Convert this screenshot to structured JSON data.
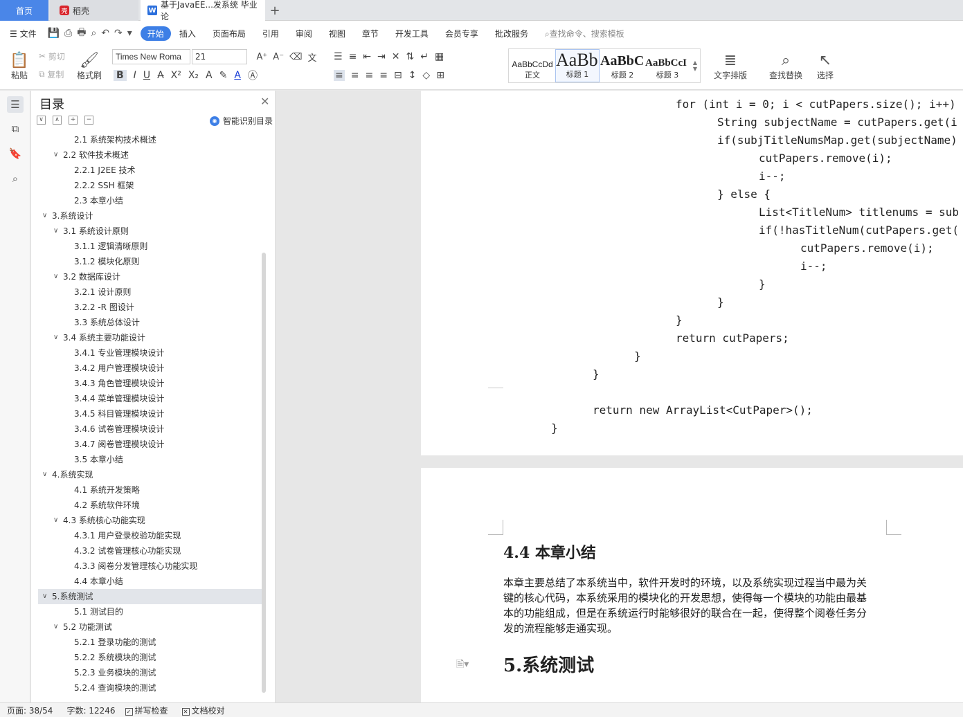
{
  "tabs": {
    "home": "首页",
    "daoke": "稻壳",
    "doc": "基于JavaEE...发系统 毕业论"
  },
  "menu": {
    "file": "文件",
    "items": [
      "开始",
      "插入",
      "页面布局",
      "引用",
      "审阅",
      "视图",
      "章节",
      "开发工具",
      "会员专享",
      "批改服务"
    ],
    "search_placeholder": "查找命令、搜索模板"
  },
  "ribbon": {
    "paste": "粘贴",
    "cut": "剪切",
    "copy": "复制",
    "format_painter": "格式刷",
    "font_name": "Times New Roma",
    "font_size": "21",
    "styles": [
      {
        "preview": "AaBbCcDd",
        "name": "正文"
      },
      {
        "preview": "AaBb",
        "name": "标题 1"
      },
      {
        "preview": "AaBbC",
        "name": "标题 2"
      },
      {
        "preview": "AaBbCcI",
        "name": "标题 3"
      }
    ],
    "text_layout": "文字排版",
    "find_replace": "查找替换",
    "select": "选择"
  },
  "toc": {
    "title": "目录",
    "smart": "智能识别目录",
    "items": [
      {
        "level": 3,
        "text": "2.1  系统架构技术概述"
      },
      {
        "level": 2,
        "arrow": "∨",
        "text": "2.2  软件技术概述"
      },
      {
        "level": 3,
        "text": "2.2.1 J2EE  技术"
      },
      {
        "level": 3,
        "text": "2.2.2 SSH  框架"
      },
      {
        "level": 3,
        "text": "2.3  本章小结"
      },
      {
        "level": 1,
        "arrow": "∨",
        "text": "3.系统设计"
      },
      {
        "level": 2,
        "arrow": "∨",
        "text": "3.1  系统设计原则"
      },
      {
        "level": 3,
        "text": "3.1.1  逻辑清晰原则"
      },
      {
        "level": 3,
        "text": "3.1.2  模块化原则"
      },
      {
        "level": 2,
        "arrow": "∨",
        "text": "3.2  数据库设计"
      },
      {
        "level": 3,
        "text": "3.2.1  设计原则"
      },
      {
        "level": 3,
        "text": "3.2.2 -R  图设计"
      },
      {
        "level": 3,
        "text": "3.3  系统总体设计"
      },
      {
        "level": 2,
        "arrow": "∨",
        "text": "3.4  系统主要功能设计"
      },
      {
        "level": 3,
        "text": "3.4.1  专业管理模块设计"
      },
      {
        "level": 3,
        "text": "3.4.2 用户管理模块设计"
      },
      {
        "level": 3,
        "text": "3.4.3  角色管理模块设计"
      },
      {
        "level": 3,
        "text": "3.4.4 菜单管理模块设计"
      },
      {
        "level": 3,
        "text": "3.4.5 科目管理模块设计"
      },
      {
        "level": 3,
        "text": "3.4.6  试卷管理模块设计"
      },
      {
        "level": 3,
        "text": "3.4.7  阅卷管理模块设计"
      },
      {
        "level": 3,
        "text": "3.5  本章小结"
      },
      {
        "level": 1,
        "arrow": "∨",
        "text": "4.系统实现"
      },
      {
        "level": 3,
        "text": "4.1  系统开发策略"
      },
      {
        "level": 3,
        "text": "4.2  系统软件环境"
      },
      {
        "level": 2,
        "arrow": "∨",
        "text": "4.3  系统核心功能实现"
      },
      {
        "level": 3,
        "text": "4.3.1  用户登录校验功能实现"
      },
      {
        "level": 3,
        "text": "4.3.2  试卷管理核心功能实现"
      },
      {
        "level": 3,
        "text": "4.3.3  阅卷分发管理核心功能实现"
      },
      {
        "level": 3,
        "text": "4.4  本章小结"
      },
      {
        "level": 1,
        "arrow": "∨",
        "text": "5.系统测试",
        "selected": true
      },
      {
        "level": 3,
        "text": "5.1  测试目的"
      },
      {
        "level": 2,
        "arrow": "∨",
        "text": "5.2  功能测试"
      },
      {
        "level": 3,
        "text": "5.2.1  登录功能的测试"
      },
      {
        "level": 3,
        "text": "5.2.2  系统模块的测试"
      },
      {
        "level": 3,
        "text": "5.2.3  业务模块的测试"
      },
      {
        "level": 3,
        "text": "5.2.4  查询模块的测试"
      }
    ]
  },
  "doc": {
    "code_lines": [
      "for (int i = 0; i < cutPapers.size(); i++)",
      "String subjectName = cutPapers.get(i",
      "if(subjTitleNumsMap.get(subjectName)",
      "cutPapers.remove(i);",
      "i--;",
      "} else {",
      "List<TitleNum> titlenums = sub",
      "if(!hasTitleNum(cutPapers.get(",
      "cutPapers.remove(i);",
      "i--;",
      "}",
      "}",
      "}",
      "return cutPapers;",
      "}",
      "}",
      "return new ArrayList<CutPaper>();",
      "}"
    ],
    "section_44": "4.4  本章小结",
    "paragraph": [
      "本章主要总结了本系统当中，软件开发时的环境，以及系统实现过程当中最为关",
      "键的核心代码，本系统采用的模块化的开发思想，使得每一个模块的功能由最基",
      "本的功能组成，但是在系统运行时能够很好的联合在一起，使得整个阅卷任务分",
      "发的流程能够走通实现。"
    ],
    "chapter_5": "5.系统测试"
  },
  "status": {
    "page": "页面: 38/54",
    "words": "字数: 12246",
    "spell": "拼写检查",
    "proof": "文档校对"
  }
}
